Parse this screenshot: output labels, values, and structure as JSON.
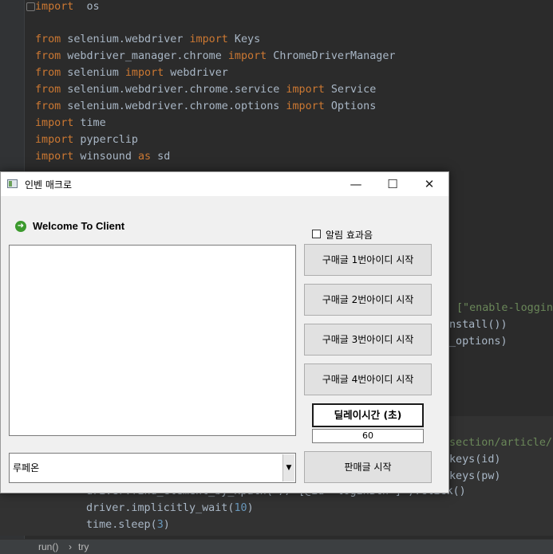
{
  "editor": {
    "lines": [
      {
        "segs": [
          [
            "kw",
            "import"
          ],
          [
            "",
            "  os"
          ]
        ]
      },
      {
        "segs": [
          [
            "kw",
            "from"
          ],
          [
            "",
            " selenium.webdriver "
          ],
          [
            "kw",
            "import"
          ],
          [
            "",
            " Keys"
          ]
        ]
      },
      {
        "segs": [
          [
            "kw",
            "from"
          ],
          [
            "",
            " webdriver_manager.chrome "
          ],
          [
            "kw",
            "import"
          ],
          [
            "",
            " ChromeDriverManager"
          ]
        ]
      },
      {
        "segs": [
          [
            "kw",
            "from"
          ],
          [
            "",
            " selenium "
          ],
          [
            "kw",
            "import"
          ],
          [
            "",
            " webdriver"
          ]
        ]
      },
      {
        "segs": [
          [
            "kw",
            "from"
          ],
          [
            "",
            " selenium.webdriver.chrome.service "
          ],
          [
            "kw",
            "import"
          ],
          [
            "",
            " Service"
          ]
        ]
      },
      {
        "segs": [
          [
            "kw",
            "from"
          ],
          [
            "",
            " selenium.webdriver.chrome.options "
          ],
          [
            "kw",
            "import"
          ],
          [
            "",
            " Options"
          ]
        ]
      },
      {
        "segs": [
          [
            "kw",
            "import"
          ],
          [
            "",
            " time"
          ]
        ]
      },
      {
        "segs": [
          [
            "kw",
            "import"
          ],
          [
            "",
            " pyperclip"
          ]
        ]
      },
      {
        "segs": [
          [
            "kw",
            "import"
          ],
          [
            "",
            " winsound "
          ],
          [
            "kw",
            "as"
          ],
          [
            "",
            " sd"
          ]
        ]
      }
    ],
    "side_fragments": [
      {
        "segs": [
          [
            "str",
            "[\"enable-loggin"
          ]
        ]
      },
      {
        "segs": [
          [
            "",
            "nstall())"
          ]
        ]
      },
      {
        "segs": [
          [
            "",
            "_options)"
          ]
        ]
      },
      {
        "segs": [
          [
            "str",
            "section/article/"
          ]
        ]
      },
      {
        "segs": [
          [
            "",
            "keys(id)"
          ]
        ]
      },
      {
        "segs": [
          [
            "",
            "keys(pw)"
          ]
        ]
      }
    ],
    "bottom_lines": [
      {
        "segs": [
          [
            "",
            "driver.find_element_by_xpath('//*[@id=\"loginBtn\"]').click()"
          ]
        ]
      },
      {
        "segs": [
          [
            "",
            "driver.implicitly_wait("
          ],
          [
            "num",
            "10"
          ],
          [
            "",
            ")"
          ]
        ]
      },
      {
        "segs": [
          [
            "",
            "time.sleep("
          ],
          [
            "num",
            "3"
          ],
          [
            "",
            ")"
          ]
        ]
      }
    ]
  },
  "statusbar": {
    "crumb1": "run()",
    "sep": "›",
    "crumb2": "try"
  },
  "window": {
    "title": "인벤 매크로",
    "minimize": "—",
    "maximize": "☐",
    "close": "✕",
    "welcome": "Welcome To Client",
    "welcome_icon": "arrow-right-circle-icon",
    "checkbox_label": "알림 효과음",
    "buttons": [
      "구매글 1번아이디 시작",
      "구매글 2번아이디 시작",
      "구매글 3번아이디 시작",
      "구매글 4번아이디 시작"
    ],
    "delay_label": "딜레이시간 (초)",
    "delay_value": "60",
    "combo_value": "루페온",
    "combo_arrow": "▼",
    "sell_button": "판매글 시작"
  },
  "colors": {
    "keyword": "#cc7832",
    "number": "#6897bb",
    "string": "#6a8759",
    "text": "#a9b7c6",
    "editor_bg": "#2b2b2b"
  }
}
